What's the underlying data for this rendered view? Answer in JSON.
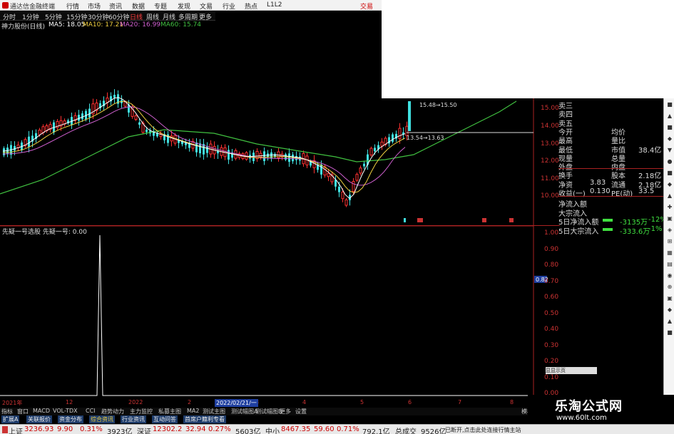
{
  "menu": {
    "app_name": "通达信金融终端",
    "items": [
      "行情",
      "市场",
      "资讯",
      "数据",
      "专题",
      "发现",
      "文易",
      "行业",
      "热点",
      "L1L2"
    ],
    "trade": "交易"
  },
  "periods": {
    "items": [
      "分时",
      "1分钟",
      "5分钟",
      "15分钟",
      "30分钟",
      "60分钟",
      "日线",
      "周线",
      "月线",
      "多周期",
      "更多"
    ],
    "active": "日线"
  },
  "legend": {
    "stock": "神力股份(日线)",
    "ma5": "MA5: 18.05",
    "ma10": "MA10: 17.21",
    "ma20": "MA20: 16.99",
    "ma60": "MA60: 15.74"
  },
  "colors": {
    "ma5": "#ffffff",
    "ma10": "#f0d040",
    "ma20": "#d060d0",
    "ma60": "#40c040",
    "up": "#ff3030",
    "down": "#40e0e0"
  },
  "annotations": {
    "high": "15.48→15.50",
    "mid": "13.54→13.63"
  },
  "price_axis": [
    "15.00",
    "14.00",
    "13.00",
    "12.00",
    "11.00",
    "10.00"
  ],
  "info": {
    "rows": [
      {
        "l": "卖三",
        "v": ""
      },
      {
        "l": "卖四",
        "v": ""
      },
      {
        "l": "卖五",
        "v": ""
      },
      {
        "l": "今开",
        "v": "",
        "l2": "均价",
        "v2": ""
      },
      {
        "l": "最高",
        "v": "",
        "l2": "量比",
        "v2": ""
      },
      {
        "l": "最低",
        "v": "",
        "l2": "市值",
        "v2": "38.4亿"
      },
      {
        "l": "现量",
        "v": "",
        "l2": "总量",
        "v2": ""
      },
      {
        "l": "外盘",
        "v": "",
        "l2": "内盘",
        "v2": ""
      },
      {
        "l": "换手",
        "v": "",
        "l2": "股本",
        "v2": "2.18亿"
      },
      {
        "l": "净资",
        "v": "3.83",
        "l2": "流通",
        "v2": "2.18亿"
      },
      {
        "l": "收益(一)",
        "v": "0.130",
        "l2": "PE(动)",
        "v2": "33.5"
      }
    ],
    "flow": [
      {
        "l": "净流入额",
        "v": ""
      },
      {
        "l": "大宗流入",
        "v": ""
      },
      {
        "l": "5日净流入额",
        "v": "-3135万",
        "p": "-12%"
      },
      {
        "l": "5日大宗流入",
        "v": "-333.6万",
        "p": "-1%"
      }
    ]
  },
  "indicator": {
    "title": "先疑一号选股 先疑一号: 0.00",
    "axis": [
      "1.00",
      "0.90",
      "0.80",
      "0.70",
      "0.60",
      "0.50",
      "0.40",
      "0.30",
      "0.20",
      "0.10",
      "0.00"
    ],
    "cursor_value": "0.82",
    "panel_buttons": "显显示页"
  },
  "dates": {
    "items": [
      "2021年",
      "12",
      "2022",
      "2",
      "3",
      "4",
      "5",
      "6",
      "7",
      "8"
    ],
    "cursor": "2022/02/21/一"
  },
  "tabs": [
    "指标",
    "窗口",
    "MACD",
    "VOL-TDX",
    "CCI",
    "趋势动力",
    "主力监控",
    "私募主图",
    "MA2",
    "测试主图",
    "测试幅图A",
    "测试幅图B",
    "更多",
    "设置"
  ],
  "tabs2": [
    "扩展A",
    "关联报价",
    "资金分布",
    "综合资讯",
    "行业资讯",
    "互动问答",
    "首席户籍利专看"
  ],
  "right_bottom": "模板",
  "status": {
    "sh_label": "上证",
    "sh": "3236.93",
    "sh_chg": "9.90",
    "sh_pct": "0.31%",
    "sh_amt": "3923亿",
    "sz_label": "深证",
    "sz": "12302.2",
    "sz_chg": "32.94",
    "sz_pct": "0.27%",
    "sz_amt": "5603亿",
    "zx_label": "中小",
    "zx": "8467.35",
    "zx_chg": "59.60",
    "zx_pct": "0.71%",
    "zx_amt": "792.1亿",
    "total_label": "总成交",
    "total": "9526亿",
    "msg": "已断开,点击此处连接行情主站"
  },
  "watermark": {
    "title": "乐淘公式网",
    "url": "www.60lt.com"
  }
}
